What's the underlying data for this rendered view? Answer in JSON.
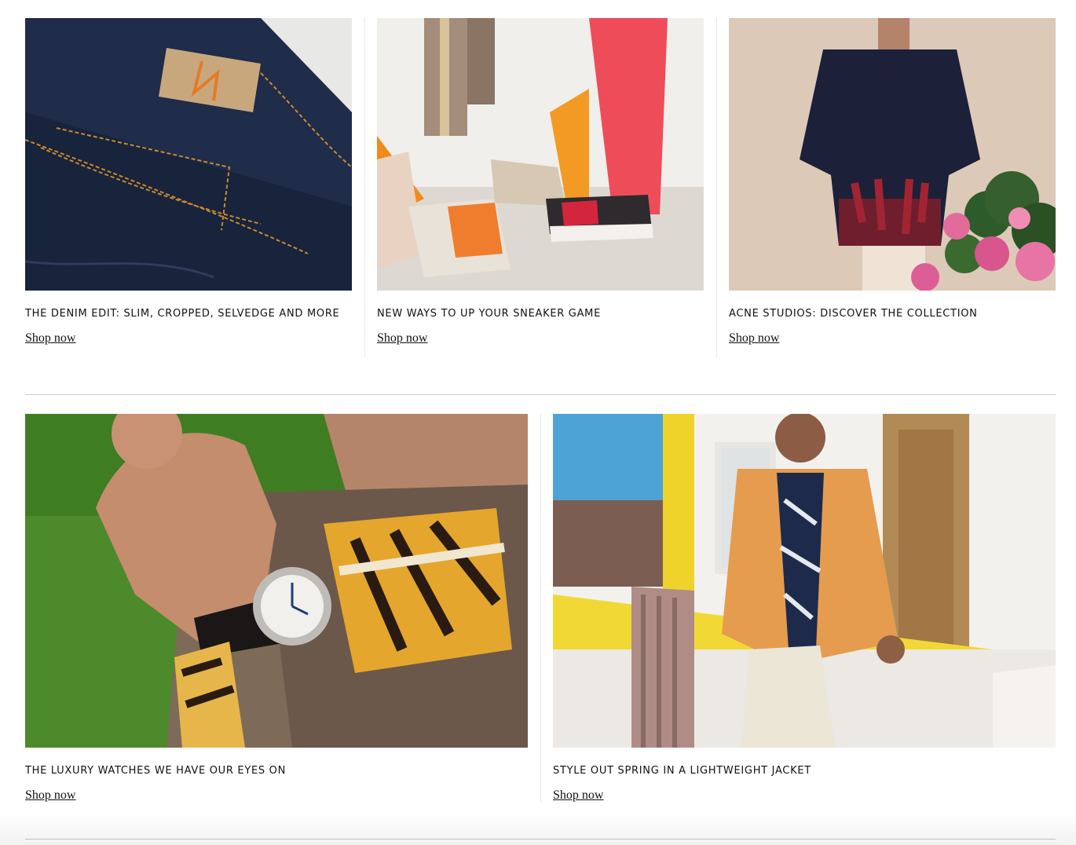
{
  "row1": [
    {
      "title": "The Denim Edit: Slim, Cropped, Selvedge and More",
      "link": "Shop now",
      "image": "jeans-closeup"
    },
    {
      "title": "New Ways to Up Your Sneaker Game",
      "link": "Shop now",
      "image": "sneakers"
    },
    {
      "title": "Acne Studios: Discover the Collection",
      "link": "Shop now",
      "image": "shirt-model"
    }
  ],
  "row2": [
    {
      "title": "The Luxury Watches We Have Our Eyes On",
      "link": "Shop now",
      "image": "watch-wrist"
    },
    {
      "title": "Style Out Spring in a Lightweight Jacket",
      "link": "Shop now",
      "image": "jacket-model"
    }
  ]
}
